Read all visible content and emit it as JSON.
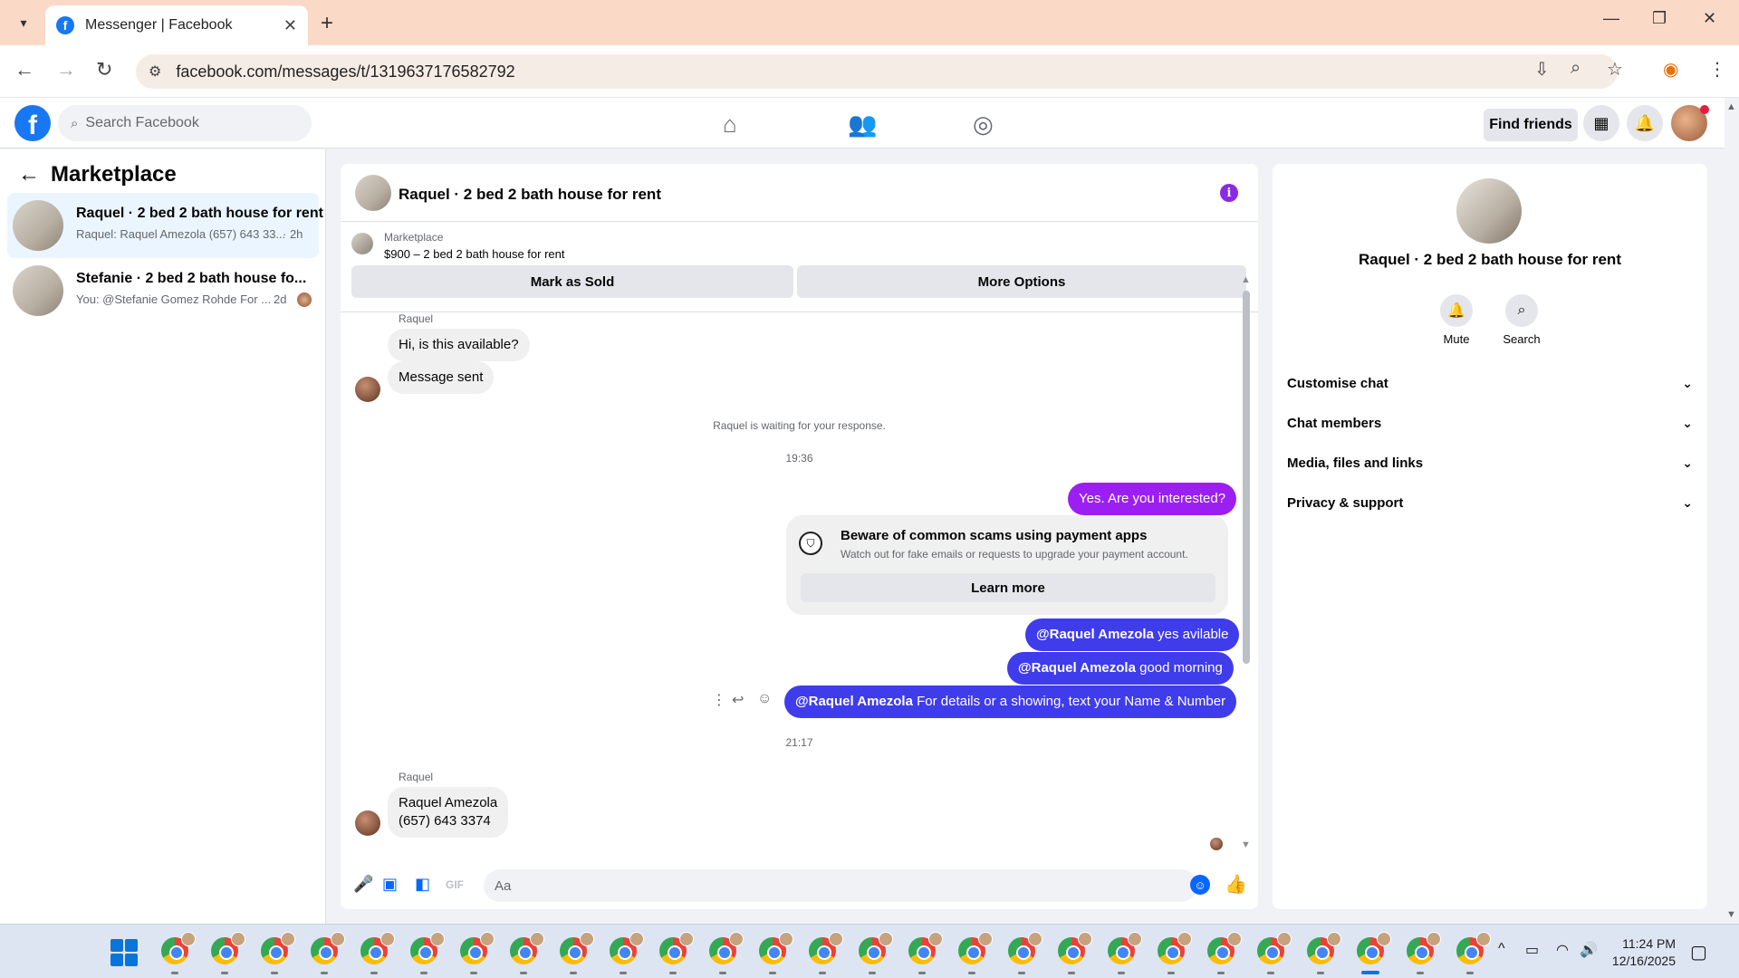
{
  "browser": {
    "tab_title": "Messenger | Facebook",
    "url": "facebook.com/messages/t/1319637176582792"
  },
  "fb": {
    "search_placeholder": "Search Facebook",
    "find_friends": "Find friends"
  },
  "sidebar": {
    "title": "Marketplace",
    "conversations": [
      {
        "title": "Raquel · 2 bed 2 bath house for rent",
        "preview": "Raquel: Raquel Amezola (657) 643 33...",
        "time": "· 2h"
      },
      {
        "title": "Stefanie · 2 bed 2 bath house fo...",
        "preview": "You: @Stefanie Gomez Rohde For ...",
        "time": "2d"
      }
    ]
  },
  "chat": {
    "title": "Raquel · 2 bed 2 bath house for rent",
    "listing_source": "Marketplace",
    "listing_name": "$900 – 2 bed 2 bath house for rent",
    "mark_sold": "Mark as Sold",
    "more_options": "More Options",
    "sender1": "Raquel",
    "msg1": "Hi, is this available?",
    "msg2": "Message sent",
    "waiting": "Raquel is waiting for your response.",
    "time1": "19:36",
    "out1": "Yes. Are you interested?",
    "scam_title": "Beware of common scams using payment apps",
    "scam_text": "Watch out for fake emails or requests to upgrade your payment account.",
    "learn_more": "Learn more",
    "mention": "@Raquel Amezola",
    "out2": " yes avilable",
    "out3": " good morning",
    "out4": " For details or a showing, text your Name & Number",
    "time2": "21:17",
    "sender2": "Raquel",
    "in3_line1": "Raquel Amezola",
    "in3_line2": "(657) 643 3374",
    "composer_placeholder": "Aa",
    "gif": "GIF"
  },
  "details": {
    "name": "Raquel · 2 bed 2 bath house for rent",
    "mute": "Mute",
    "search": "Search",
    "sections": [
      "Customise chat",
      "Chat members",
      "Media, files and links",
      "Privacy & support"
    ]
  },
  "taskbar": {
    "time": "11:24 PM",
    "date": "12/16/2025"
  },
  "colors": {
    "fb_blue": "#1877f2",
    "outgoing_purple": "#9b1ff2",
    "outgoing_blue": "#3f3cec",
    "active_row": "#ebf5ff"
  }
}
